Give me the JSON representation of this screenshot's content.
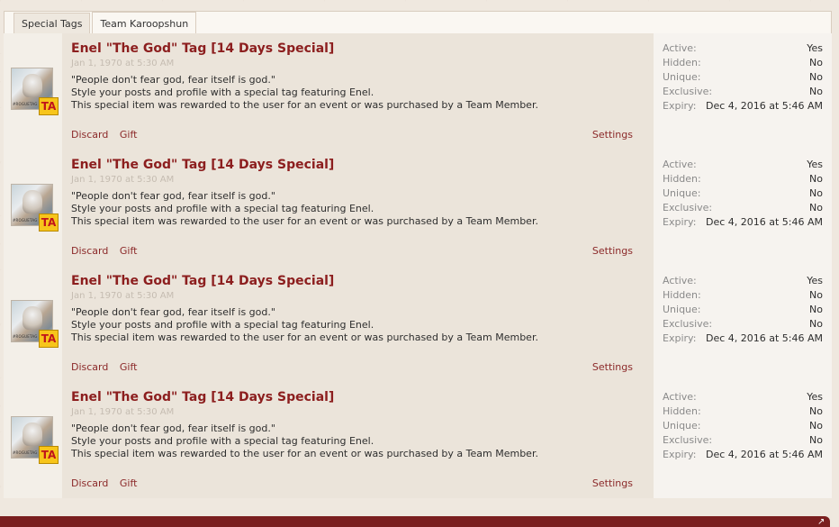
{
  "tabs": [
    {
      "label": "Special Tags",
      "active": false
    },
    {
      "label": "Team Karoopshun",
      "active": true
    }
  ],
  "items": [
    {
      "title": "Enel \"The God\" Tag [14 Days Special]",
      "date": "Jan 1, 1970 at 5:30 AM",
      "thumb_caption": "#ROGUETAG",
      "badge": "TA",
      "desc": [
        "\"People don't fear god, fear itself is god.\"",
        "Style your posts and profile with a special tag featuring Enel.",
        "This special item was rewarded to the user for an event or was purchased by a Team Member."
      ],
      "actions": {
        "discard": "Discard",
        "gift": "Gift",
        "settings": "Settings"
      },
      "stats": [
        {
          "label": "Active:",
          "value": "Yes"
        },
        {
          "label": "Hidden:",
          "value": "No"
        },
        {
          "label": "Unique:",
          "value": "No"
        },
        {
          "label": "Exclusive:",
          "value": "No"
        },
        {
          "label": "Expiry:",
          "value": "Dec 4, 2016 at 5:46 AM"
        }
      ]
    },
    {
      "title": "Enel \"The God\" Tag [14 Days Special]",
      "date": "Jan 1, 1970 at 5:30 AM",
      "thumb_caption": "#ROGUETAG",
      "badge": "TA",
      "desc": [
        "\"People don't fear god, fear itself is god.\"",
        "Style your posts and profile with a special tag featuring Enel.",
        "This special item was rewarded to the user for an event or was purchased by a Team Member."
      ],
      "actions": {
        "discard": "Discard",
        "gift": "Gift",
        "settings": "Settings"
      },
      "stats": [
        {
          "label": "Active:",
          "value": "Yes"
        },
        {
          "label": "Hidden:",
          "value": "No"
        },
        {
          "label": "Unique:",
          "value": "No"
        },
        {
          "label": "Exclusive:",
          "value": "No"
        },
        {
          "label": "Expiry:",
          "value": "Dec 4, 2016 at 5:46 AM"
        }
      ]
    },
    {
      "title": "Enel \"The God\" Tag [14 Days Special]",
      "date": "Jan 1, 1970 at 5:30 AM",
      "thumb_caption": "#ROGUETAG",
      "badge": "TA",
      "desc": [
        "\"People don't fear god, fear itself is god.\"",
        "Style your posts and profile with a special tag featuring Enel.",
        "This special item was rewarded to the user for an event or was purchased by a Team Member."
      ],
      "actions": {
        "discard": "Discard",
        "gift": "Gift",
        "settings": "Settings"
      },
      "stats": [
        {
          "label": "Active:",
          "value": "Yes"
        },
        {
          "label": "Hidden:",
          "value": "No"
        },
        {
          "label": "Unique:",
          "value": "No"
        },
        {
          "label": "Exclusive:",
          "value": "No"
        },
        {
          "label": "Expiry:",
          "value": "Dec 4, 2016 at 5:46 AM"
        }
      ]
    },
    {
      "title": "Enel \"The God\" Tag [14 Days Special]",
      "date": "Jan 1, 1970 at 5:30 AM",
      "thumb_caption": "#ROGUETAG",
      "badge": "TA",
      "desc": [
        "\"People don't fear god, fear itself is god.\"",
        "Style your posts and profile with a special tag featuring Enel.",
        "This special item was rewarded to the user for an event or was purchased by a Team Member."
      ],
      "actions": {
        "discard": "Discard",
        "gift": "Gift",
        "settings": "Settings"
      },
      "stats": [
        {
          "label": "Active:",
          "value": "Yes"
        },
        {
          "label": "Hidden:",
          "value": "No"
        },
        {
          "label": "Unique:",
          "value": "No"
        },
        {
          "label": "Exclusive:",
          "value": "No"
        },
        {
          "label": "Expiry:",
          "value": "Dec 4, 2016 at 5:46 AM"
        }
      ]
    }
  ],
  "colors": {
    "title": "#8c1e1e",
    "link": "#8c2a2a",
    "badge_bg": "#f7c51b",
    "badge_text": "#c0141a",
    "footer": "#7a1f1f"
  },
  "icons": {
    "resize": "resize-corner-icon"
  }
}
